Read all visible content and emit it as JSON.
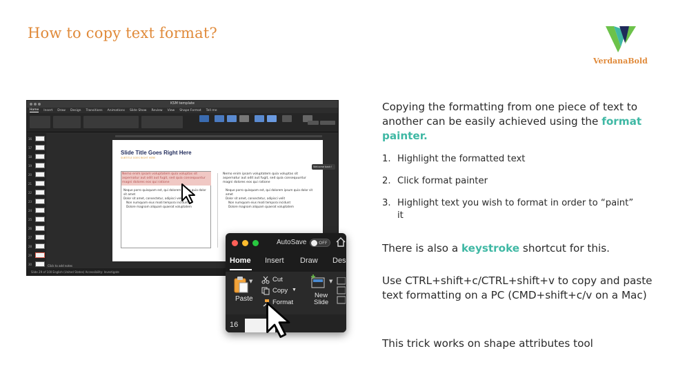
{
  "slide": {
    "title": "How to copy text format?",
    "brand_name": "VerdanaBold",
    "brand_colors": {
      "accent_orange": "#e08a3a",
      "teal": "#3fb8a4",
      "green": "#6cc24a",
      "navy": "#1f2a5a"
    }
  },
  "screenshot": {
    "doc_title": "KSM template",
    "tabs": [
      "Home",
      "Insert",
      "Draw",
      "Design",
      "Transitions",
      "Animations",
      "Slide Show",
      "Review",
      "View",
      "Shape Format",
      "Tell me"
    ],
    "slide_title": "Slide Title Goes Right Here",
    "slide_subtitle": "SUBTITLE GOES RIGHT HERE",
    "highlighted_text": "Nemo enim ipsam voluptatem quia voluptas sit aspernatur aut odit aut fugit, sed quia consequuntur magni dolores eos qui ratione",
    "left_bullets": [
      "Neque porro quisquam est, qui dolorem ipsum quia dolor sit amet",
      "Dolor sit amet, consectetur, adipisci velit",
      "Non numquam eius modi tempora incidunt",
      "Dolore magnam aliquam quaerat voluptatem"
    ],
    "right_para": "Nemo enim ipsam voluptatem quia voluptas sit aspernatur aut odit aut fugit, sed quia consequuntur magni dolores eos qui ratione",
    "right_bullets": [
      "Neque porro quisquam est, qui dolorem ipsum quia dolor sit amet",
      "Dolor sit amet, consectetur, adipisci velit",
      "Non numquam eius modi tempora incidunt",
      "Dolore magnam aliquam quaerat voluptatem"
    ],
    "welcome": "Welcome back!",
    "notes": "Click to add notes",
    "status": "Slide 29 of 100   English (United States)   Accessibility: Investigate"
  },
  "zoom": {
    "autosave_label": "AutoSave",
    "toggle_state": "OFF",
    "tabs": [
      "Home",
      "Insert",
      "Draw",
      "Des"
    ],
    "paste_label": "Paste",
    "cut_label": "Cut",
    "copy_label": "Copy",
    "format_label": "Format",
    "new_slide_label_1": "New",
    "new_slide_label_2": "Slide",
    "slide_number": "16"
  },
  "content": {
    "lead_1": "Copying the formatting from one piece of text to another can be easily achieved using the ",
    "lead_accent": "format painter.",
    "steps": [
      {
        "num": "1.",
        "text": "Highlight the formatted text"
      },
      {
        "num": "2.",
        "text": "Click format painter"
      },
      {
        "num": "3.",
        "text": "Highlight text you wish to format in order to “paint” it"
      }
    ],
    "keystroke_1": "There is also a ",
    "keystroke_accent": "keystroke",
    "keystroke_2": " shortcut for this.",
    "shortcut_text": "Use CTRL+shift+c/CTRL+shift+v to copy and paste text formatting on a PC (CMD+shift+c/v on a Mac)",
    "trick_text": "This trick works on shape attributes tool"
  }
}
